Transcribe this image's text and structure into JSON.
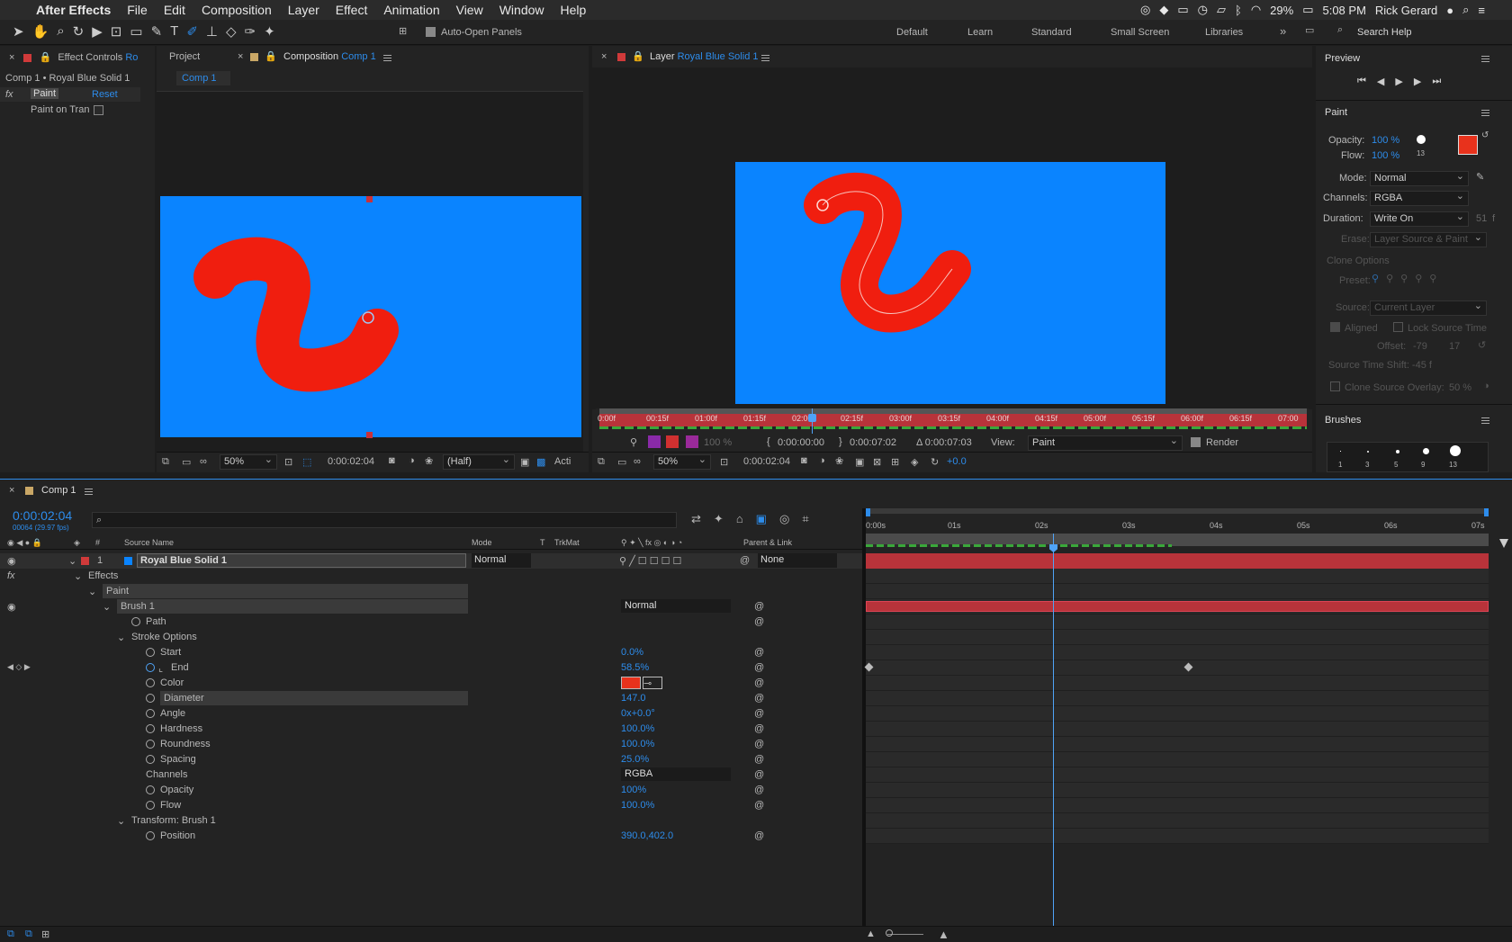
{
  "menubar": {
    "app": "After Effects",
    "items": [
      "File",
      "Edit",
      "Composition",
      "Layer",
      "Effect",
      "Animation",
      "View",
      "Window",
      "Help"
    ],
    "battery": "29%",
    "time": "5:08 PM",
    "user": "Rick Gerard"
  },
  "toolbar": {
    "auto_open": "Auto-Open Panels",
    "workspaces": [
      "Default",
      "Learn",
      "Standard",
      "Small Screen",
      "Libraries"
    ],
    "search_placeholder": "Search Help"
  },
  "effect_controls": {
    "tab": "Effect Controls",
    "tab_layer": "Ro",
    "header": "Comp 1 • Royal Blue Solid 1",
    "fx_label": "fx",
    "effect_name": "Paint",
    "reset": "Reset",
    "paint_on_transparent": "Paint on Tran"
  },
  "composition": {
    "tab_project": "Project",
    "tab_label": "Composition",
    "tab_comp": "Comp 1",
    "subtab": "Comp 1",
    "zoom": "50%",
    "time": "0:00:02:04",
    "resolution": "(Half)",
    "active": "Acti"
  },
  "layer_panel": {
    "tab_label": "Layer",
    "tab_layer": "Royal Blue Solid 1",
    "ruler": [
      "0:00f",
      "00:15f",
      "01:00f",
      "01:15f",
      "02:00",
      "02:15f",
      "03:00f",
      "03:15f",
      "04:00f",
      "04:15f",
      "05:00f",
      "05:15f",
      "06:00f",
      "06:15f",
      "07:00"
    ],
    "opacity": "100 %",
    "in_time": "0:00:00:00",
    "out_time": "0:00:07:02",
    "duration": "Δ 0:00:07:03",
    "view_label": "View:",
    "view_value": "Paint",
    "render": "Render",
    "zoom": "50%",
    "time": "0:00:02:04",
    "exposure": "+0.0"
  },
  "preview": {
    "title": "Preview"
  },
  "paint": {
    "title": "Paint",
    "opacity_label": "Opacity:",
    "opacity": "100 %",
    "flow_label": "Flow:",
    "flow": "100 %",
    "brush_size": "13",
    "mode_label": "Mode:",
    "mode": "Normal",
    "channels_label": "Channels:",
    "channels": "RGBA",
    "duration_label": "Duration:",
    "duration": "Write On",
    "duration_frames": "51",
    "duration_unit": "f",
    "erase_label": "Erase:",
    "erase": "Layer Source & Paint",
    "clone_options": "Clone Options",
    "preset_label": "Preset:",
    "source_label": "Source:",
    "source": "Current Layer",
    "aligned": "Aligned",
    "lock_source_time": "Lock Source Time",
    "offset_label": "Offset:",
    "offset_x": "-79",
    "offset_y": "17",
    "source_time_shift": "Source Time Shift: -45  f",
    "clone_overlay": "Clone Source Overlay:",
    "clone_overlay_value": "50 %",
    "fg_color": "#e8321c",
    "bg_color": "#ffffff"
  },
  "brushes": {
    "title": "Brushes",
    "sizes": [
      "1",
      "3",
      "5",
      "9",
      "13"
    ]
  },
  "timeline": {
    "tab": "Comp 1",
    "timecode": "0:00:02:04",
    "frames": "00064 (29.97 fps)",
    "search_placeholder": "",
    "cols": {
      "num": "#",
      "source": "Source Name",
      "mode": "Mode",
      "t": "T",
      "trkmat": "TrkMat",
      "parent": "Parent & Link"
    },
    "ruler": [
      "0:00s",
      "01s",
      "02s",
      "03s",
      "04s",
      "05s",
      "06s",
      "07s"
    ],
    "layer": {
      "num": "1",
      "name": "Royal Blue Solid 1",
      "mode": "Normal",
      "parent": "None"
    },
    "rows": [
      {
        "label": "Effects",
        "value": ""
      },
      {
        "label": "Paint",
        "value": ""
      },
      {
        "label": "Brush 1",
        "value": "Normal"
      },
      {
        "label": "Path",
        "value": ""
      },
      {
        "label": "Stroke Options",
        "value": ""
      },
      {
        "label": "Start",
        "value": "0.0%"
      },
      {
        "label": "End",
        "value": "58.5%"
      },
      {
        "label": "Color",
        "value": ""
      },
      {
        "label": "Diameter",
        "value": "147.0"
      },
      {
        "label": "Angle",
        "value": "0x+0.0°"
      },
      {
        "label": "Hardness",
        "value": "100.0%"
      },
      {
        "label": "Roundness",
        "value": "100.0%"
      },
      {
        "label": "Spacing",
        "value": "25.0%"
      },
      {
        "label": "Channels",
        "value": "RGBA"
      },
      {
        "label": "Opacity",
        "value": "100%"
      },
      {
        "label": "Flow",
        "value": "100.0%"
      },
      {
        "label": "Transform: Brush 1",
        "value": ""
      },
      {
        "label": "Position",
        "value": "390.0,402.0"
      }
    ]
  },
  "colors": {
    "solid": "#0a84ff",
    "paint": "#f01e0f",
    "accent": "#2d8ceb",
    "layer_bar": "#b8333a"
  }
}
